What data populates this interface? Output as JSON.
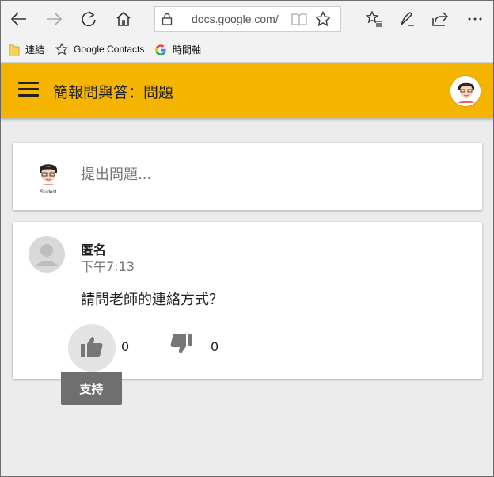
{
  "browser": {
    "url": "docs.google.com/",
    "icons": [
      "back-icon",
      "forward-icon",
      "refresh-icon",
      "home-icon",
      "lock-icon",
      "reading-view-icon",
      "favorite-star-icon",
      "favorites-hub-icon",
      "pen-icon",
      "share-icon",
      "more-icon"
    ]
  },
  "bookmarks": {
    "items": [
      {
        "label": "連結",
        "icon": "folder-icon"
      },
      {
        "label": "Google Contacts",
        "icon": "star-icon"
      },
      {
        "label": "時間軸",
        "icon": "google-g-icon"
      }
    ]
  },
  "header": {
    "title": "簡報問與答：問題",
    "color": "#f4b400",
    "avatar_text": "Student"
  },
  "ask": {
    "placeholder": "提出問題...",
    "avatar_text": "Student"
  },
  "question": {
    "author": "匿名",
    "time": "下午7:13",
    "text": "請問老師的連絡方式？",
    "upvotes": "0",
    "downvotes": "0",
    "tooltip": "支持"
  }
}
